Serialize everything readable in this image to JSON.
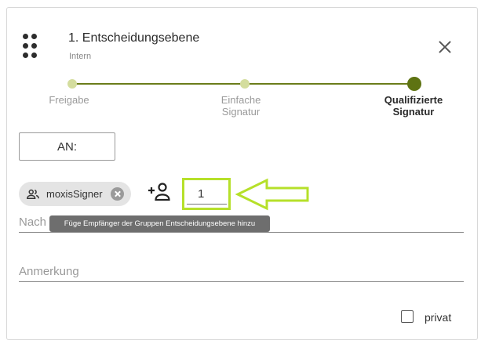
{
  "header": {
    "title": "1. Entscheidungsebene",
    "subtitle": "Intern"
  },
  "steps": [
    {
      "label_line1": "Freigabe",
      "label_line2": "",
      "active": false
    },
    {
      "label_line1": "Einfache",
      "label_line2": "Signatur",
      "active": false
    },
    {
      "label_line1": "Qualifizierte",
      "label_line2": "Signatur",
      "active": true
    }
  ],
  "recipient_button": {
    "label": "AN:"
  },
  "recipient_chip": {
    "label": "moxisSigner",
    "icon": "group-icon"
  },
  "add_recipient": {
    "icon": "person-add-icon"
  },
  "count_input": {
    "value": "1"
  },
  "search": {
    "placeholder": "Nach Empfänger, Gruppe oder Kontakts suchen"
  },
  "tooltip": {
    "text": "Füge Empfänger der Gruppen Entscheidungsebene hinzu"
  },
  "note": {
    "placeholder": "Anmerkung"
  },
  "privat": {
    "label": "privat",
    "checked": false
  },
  "colors": {
    "step_line": "#6b7d1a",
    "step_dot_inactive": "#d4dd9e",
    "step_dot_active": "#5e7312",
    "highlight": "#b6e02a"
  }
}
